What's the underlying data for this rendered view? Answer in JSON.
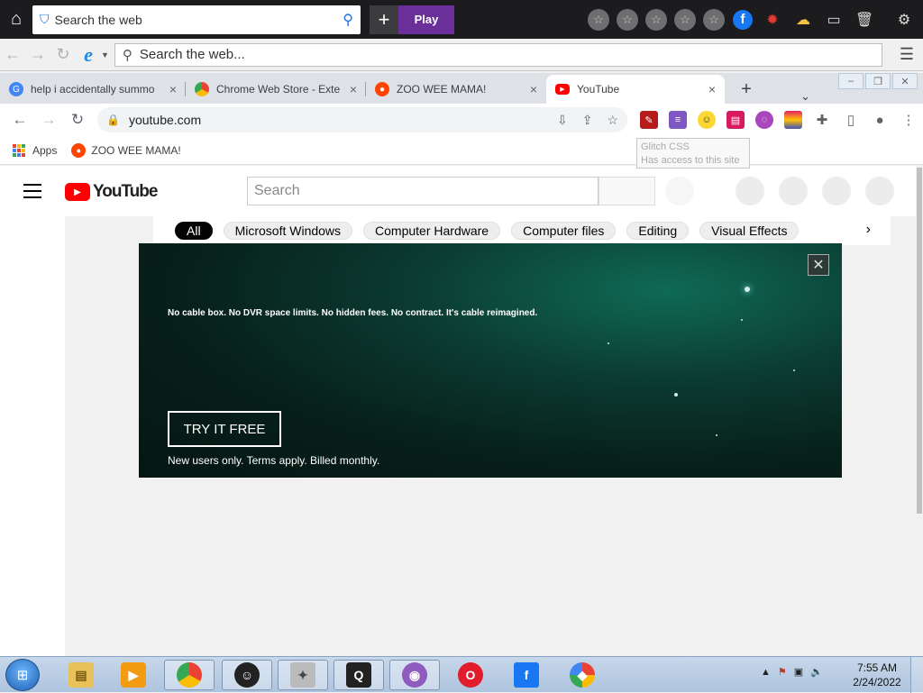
{
  "topbar": {
    "search_placeholder": "Search the web",
    "play_label": "Play"
  },
  "iebar": {
    "address_placeholder": "Search the web..."
  },
  "tabs": [
    {
      "title": "help i accidentally summo",
      "favicon": "google-icon",
      "color": "#4285f4"
    },
    {
      "title": "Chrome Web Store - Exte",
      "favicon": "chrome-icon",
      "color": "#34a853"
    },
    {
      "title": "ZOO WEE MAMA!",
      "favicon": "reddit-icon",
      "color": "#ff4500"
    },
    {
      "title": "YouTube",
      "favicon": "youtube-icon",
      "color": "#ff0000"
    }
  ],
  "omnibox": {
    "url": "youtube.com"
  },
  "bookmarks": {
    "apps_label": "Apps",
    "item_label": "ZOO WEE MAMA!"
  },
  "tooltip": {
    "title": "Glitch CSS",
    "subtitle": "Has access to this site"
  },
  "youtube": {
    "logo_text": "YouTube",
    "search_placeholder": "Search",
    "chips": [
      "All",
      "Microsoft Windows",
      "Computer Hardware",
      "Computer files",
      "Editing",
      "Visual Effects"
    ],
    "ad": {
      "tagline": "No cable box. No DVR space limits. No hidden fees. No contract. It's cable reimagined.",
      "cta": "TRY IT FREE",
      "fine_print": "New users only. Terms apply. Billed monthly."
    }
  },
  "taskbar": {
    "time": "7:55 AM",
    "date": "2/24/2022"
  }
}
